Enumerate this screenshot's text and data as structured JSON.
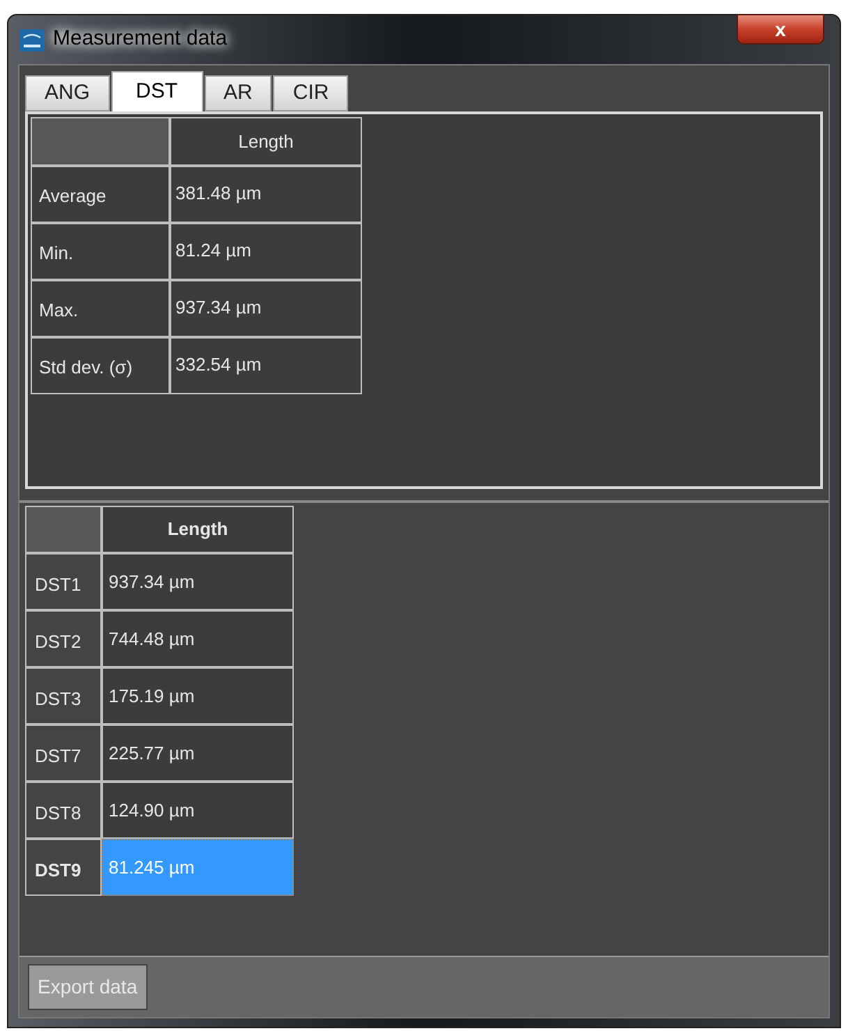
{
  "window": {
    "title": "Measurement data",
    "close": "x"
  },
  "tabs": [
    {
      "label": "ANG",
      "selected": false
    },
    {
      "label": "DST",
      "selected": true
    },
    {
      "label": "AR",
      "selected": false
    },
    {
      "label": "CIR",
      "selected": false
    }
  ],
  "summary": {
    "columns": [
      "Length"
    ],
    "rows": [
      {
        "label": "Average",
        "value": "381.48 µm"
      },
      {
        "label": "Min.",
        "value": "81.24 µm"
      },
      {
        "label": "Max.",
        "value": "937.34 µm"
      },
      {
        "label": "Std dev. (σ)",
        "value": "332.54 µm"
      }
    ]
  },
  "measurements": {
    "columns": [
      "Length"
    ],
    "rows": [
      {
        "label": "DST1",
        "value": "937.34 µm",
        "selected": false
      },
      {
        "label": "DST2",
        "value": "744.48 µm",
        "selected": false
      },
      {
        "label": "DST3",
        "value": "175.19 µm",
        "selected": false
      },
      {
        "label": "DST7",
        "value": "225.77 µm",
        "selected": false
      },
      {
        "label": "DST8",
        "value": "124.90 µm",
        "selected": false
      },
      {
        "label": "DST9",
        "value": "81.245 µm",
        "selected": true
      }
    ]
  },
  "export_button": "Export data"
}
